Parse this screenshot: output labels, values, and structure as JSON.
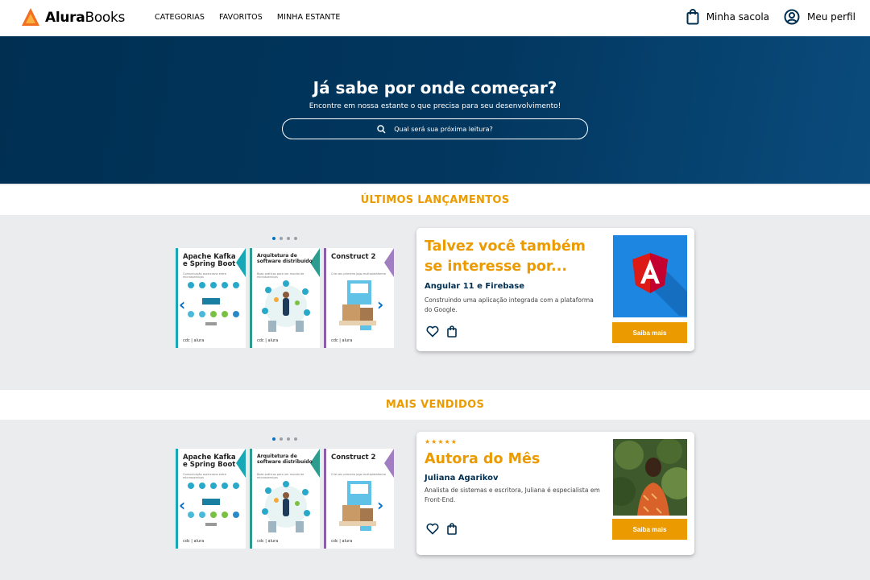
{
  "brand": {
    "name_bold": "Alura",
    "name_rest": "Books"
  },
  "nav": [
    "CATEGORIAS",
    "FAVORITOS",
    "MINHA ESTANTE"
  ],
  "header": {
    "bag_label": "Minha sacola",
    "profile_label": "Meu perfil"
  },
  "hero": {
    "title": "Já sabe por onde começar?",
    "subtitle": "Encontre em nossa estante o que precisa para seu desenvolvimento!",
    "search_placeholder": "Qual será sua próxima leitura?"
  },
  "colors": {
    "accent": "#eb9b00",
    "navy": "#002f52",
    "link": "#0b6fc4"
  },
  "sections": [
    {
      "title": "ÚLTIMOS LANÇAMENTOS",
      "books": [
        {
          "title": "Apache Kafka e Spring Boot",
          "subtitle": "Comunicação assíncrona entre microsserviços"
        },
        {
          "title": "Arquitetura de software distribuído",
          "subtitle": "Boas práticas para um mundo de microsserviços"
        },
        {
          "title": "Construct 2",
          "subtitle": "Crie seu primeiro jogo multiplataforma"
        }
      ],
      "card": {
        "title": "Talvez você também se interesse por...",
        "item_title": "Angular 11 e Firebase",
        "item_desc": "Construindo uma aplicação integrada com a plataforma do Google.",
        "button": "Saiba mais"
      }
    },
    {
      "title": "MAIS VENDIDOS",
      "books": [
        {
          "title": "Apache Kafka e Spring Boot",
          "subtitle": "Comunicação assíncrona entre microsserviços"
        },
        {
          "title": "Arquitetura de software distribuído",
          "subtitle": "Boas práticas para um mundo de microsserviços"
        },
        {
          "title": "Construct 2",
          "subtitle": "Crie seu primeiro jogo multiplataforma"
        }
      ],
      "card": {
        "stars": "★★★★★",
        "title": "Autora do Mês",
        "item_title": "Juliana Agarikov",
        "item_desc": "Analista de sistemas e escritora, Juliana é especialista em Front-End.",
        "button": "Saiba mais"
      }
    }
  ],
  "book_footer": "cdc | alura"
}
